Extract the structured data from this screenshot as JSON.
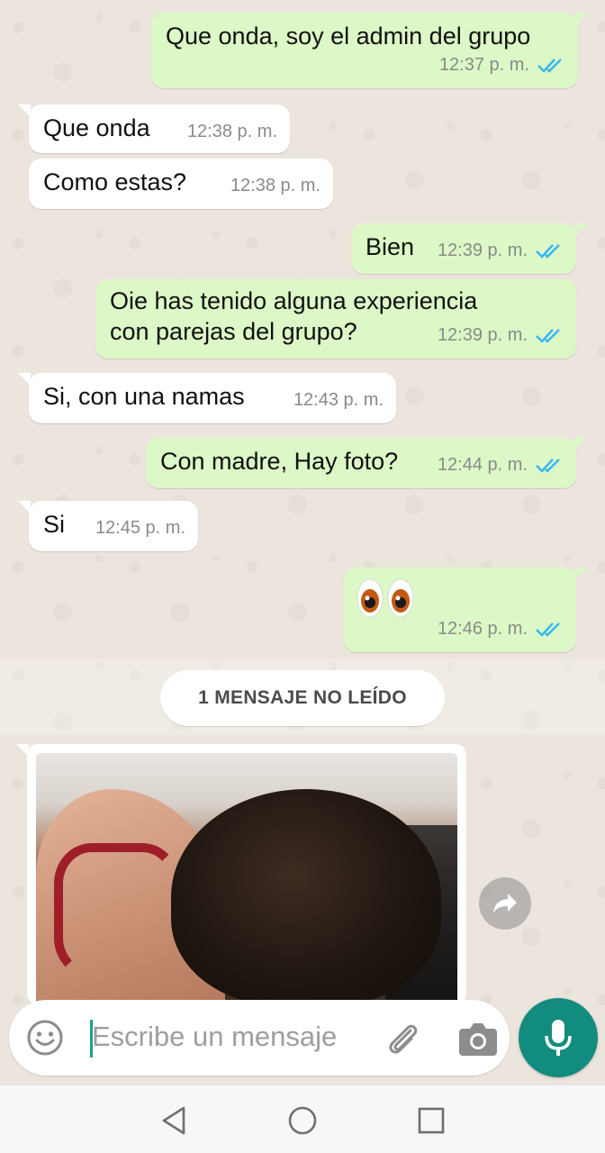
{
  "messages": [
    {
      "dir": "out",
      "text": "Que onda, soy el admin del grupo",
      "time": "12:37 p. m."
    },
    {
      "dir": "in",
      "text": "Que onda",
      "time": "12:38 p. m."
    },
    {
      "dir": "in",
      "text": "Como estas?",
      "time": "12:38 p. m."
    },
    {
      "dir": "out",
      "text": "Bien",
      "time": "12:39 p. m."
    },
    {
      "dir": "out",
      "text_line1": "Oie has tenido alguna experiencia",
      "text_line2": "con parejas del grupo?",
      "time": "12:39 p. m."
    },
    {
      "dir": "in",
      "text": "Si, con una namas",
      "time": "12:43 p. m."
    },
    {
      "dir": "out",
      "text": "Con madre, Hay foto?",
      "time": "12:44 p. m."
    },
    {
      "dir": "in",
      "text": "Si",
      "time": "12:45 p. m."
    },
    {
      "dir": "out",
      "emoji": "eyes",
      "time": "12:46 p. m."
    }
  ],
  "unread_banner": "1 MENSAJE NO LEÍDO",
  "composer": {
    "placeholder": "Escribe un mensaje",
    "emoji_icon": "emoji-icon",
    "attach_icon": "paperclip-icon",
    "camera_icon": "camera-icon",
    "mic_icon": "microphone-icon"
  },
  "colors": {
    "outgoing_bubble": "#dcf8c6",
    "incoming_bubble": "#ffffff",
    "read_ticks": "#34b7f1",
    "accent": "#128c7e"
  }
}
